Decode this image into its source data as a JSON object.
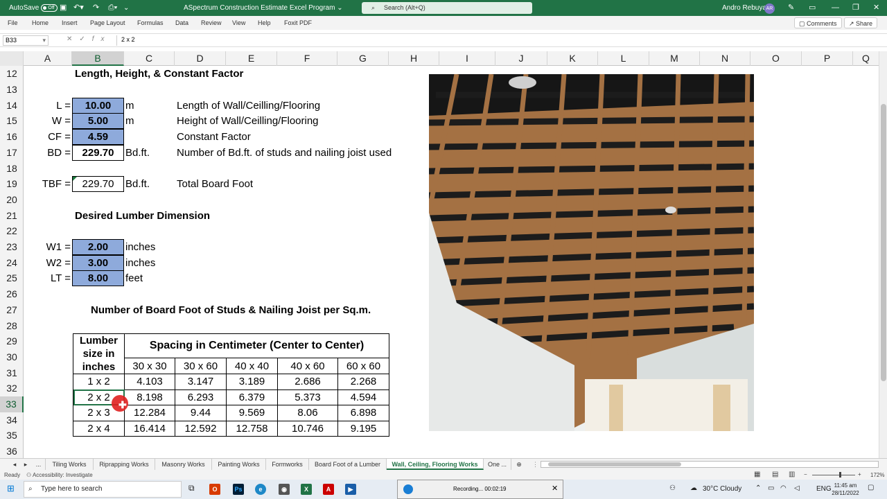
{
  "titlebar": {
    "autosave": "AutoSave",
    "autosave_state": "Off",
    "doc_title": "ASpectrum Construction Estimate Excel Program",
    "search": "Search (Alt+Q)",
    "user": "Andro Rebuyas",
    "initials": "AR"
  },
  "menu": [
    "File",
    "Home",
    "Insert",
    "Page Layout",
    "Formulas",
    "Data",
    "Review",
    "View",
    "Help",
    "Foxit PDF"
  ],
  "menu_right": {
    "comments": "Comments",
    "share": "Share"
  },
  "formula": {
    "cell": "B33",
    "value": "2 x 2"
  },
  "columns": [
    "A",
    "B",
    "C",
    "D",
    "E",
    "F",
    "G",
    "H",
    "I",
    "J",
    "K",
    "L",
    "M",
    "N",
    "O",
    "P",
    "Q"
  ],
  "rows": [
    "12",
    "13",
    "14",
    "15",
    "16",
    "17",
    "18",
    "19",
    "20",
    "21",
    "22",
    "23",
    "24",
    "25",
    "26",
    "27",
    "28",
    "29",
    "30",
    "31",
    "32",
    "33",
    "34",
    "35",
    "36"
  ],
  "sheet": {
    "heading1": "Length, Height, & Constant Factor",
    "params": [
      {
        "label": "L =",
        "value": "10.00",
        "unit": "m",
        "desc": "Length of Wall/Ceilling/Flooring"
      },
      {
        "label": "W =",
        "value": "5.00",
        "unit": "m",
        "desc": "Height of Wall/Ceilling/Flooring"
      },
      {
        "label": "CF =",
        "value": "4.59",
        "unit": "",
        "desc": "Constant Factor"
      },
      {
        "label": "BD =",
        "value": "229.70",
        "unit": "Bd.ft.",
        "desc": "Number of Bd.ft. of studs and nailing joist used"
      }
    ],
    "tbf": {
      "label": "TBF =",
      "value": "229.70",
      "unit": "Bd.ft.",
      "desc": "Total Board Foot"
    },
    "heading2": "Desired Lumber Dimension",
    "dims": [
      {
        "label": "W1 =",
        "value": "2.00",
        "unit": "inches"
      },
      {
        "label": "W2 =",
        "value": "3.00",
        "unit": "inches"
      },
      {
        "label": "LT =",
        "value": "8.00",
        "unit": "feet"
      }
    ],
    "heading3": "Number of Board Foot of Studs & Nailing Joist per Sq.m.",
    "table": {
      "col1_header": [
        "Lumber",
        "size in",
        "inches"
      ],
      "span_header": "Spacing in Centimeter (Center to Center)",
      "spacings": [
        "30 x 30",
        "30 x 60",
        "40 x 40",
        "40 x 60",
        "60 x 60"
      ],
      "rows": [
        {
          "size": "1 x 2",
          "vals": [
            "4.103",
            "3.147",
            "3.189",
            "2.686",
            "2.268"
          ]
        },
        {
          "size": "2 x 2",
          "vals": [
            "8.198",
            "6.293",
            "6.379",
            "5.373",
            "4.594"
          ]
        },
        {
          "size": "2 x 3",
          "vals": [
            "12.284",
            "9.44",
            "9.569",
            "8.06",
            "6.898"
          ]
        },
        {
          "size": "2 x 4",
          "vals": [
            "16.414",
            "12.592",
            "12.758",
            "10.746",
            "9.195"
          ]
        }
      ]
    }
  },
  "tabs": [
    "...",
    "Tiling Works",
    "Riprapping Works",
    "Masonry Works",
    "Painting Works",
    "Formworks",
    "Board Foot of a Lumber",
    "Wall, Ceiling, Flooring Works",
    "One ..."
  ],
  "status": {
    "ready": "Ready",
    "accessibility": "Accessibility: Investigate",
    "zoom": "172%"
  },
  "recording": "Recording... 00:02:19",
  "taskbar": {
    "search": "Type here to search",
    "weather": "30°C  Cloudy",
    "lang": "ENG",
    "time": "11:45 am",
    "date": "28/11/2022"
  }
}
